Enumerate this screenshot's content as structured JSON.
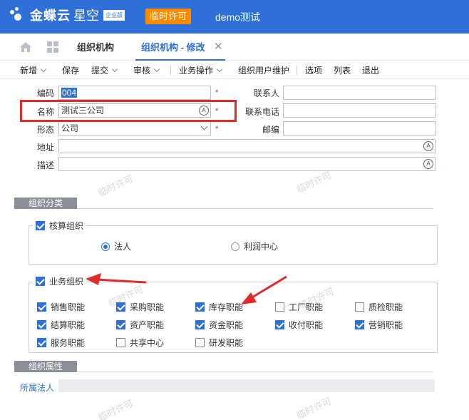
{
  "header": {
    "brand": "金蝶云",
    "brand_sub": "星空",
    "edition_badge": "企业版",
    "license_button": "临时许可",
    "tenant": "demo测试"
  },
  "tabs": [
    {
      "label": "组织机构"
    },
    {
      "label": "组织机构 - 修改"
    }
  ],
  "toolbar": {
    "new": "新增",
    "save": "保存",
    "submit": "提交",
    "audit": "审核",
    "business": "业务操作",
    "org_user": "组织用户维护",
    "options": "选项",
    "list": "列表",
    "exit": "退出"
  },
  "form": {
    "code_label": "编码",
    "code_value": "004",
    "name_label": "名称",
    "name_value": "测试三公司",
    "form_label": "形态",
    "form_value": "公司",
    "address_label": "地址",
    "desc_label": "描述",
    "contact_label": "联系人",
    "phone_label": "联系电话",
    "postcode_label": "邮编",
    "required_mark": "*",
    "at_symbol": "A"
  },
  "org_category": {
    "section_title": "组织分类",
    "accounting": {
      "title": "核算组织",
      "options": [
        {
          "label": "法人",
          "selected": true
        },
        {
          "label": "利润中心",
          "selected": false
        }
      ]
    },
    "business": {
      "title": "业务组织",
      "functions": [
        {
          "label": "销售职能",
          "checked": true
        },
        {
          "label": "采购职能",
          "checked": true
        },
        {
          "label": "库存职能",
          "checked": true
        },
        {
          "label": "工厂职能",
          "checked": false
        },
        {
          "label": "质检职能",
          "checked": false
        },
        {
          "label": "结算职能",
          "checked": true
        },
        {
          "label": "资产职能",
          "checked": true
        },
        {
          "label": "资金职能",
          "checked": true
        },
        {
          "label": "收付职能",
          "checked": true
        },
        {
          "label": "营销职能",
          "checked": true
        },
        {
          "label": "服务职能",
          "checked": true
        },
        {
          "label": "共享中心",
          "checked": false
        },
        {
          "label": "研发职能",
          "checked": false
        }
      ]
    }
  },
  "org_attr": {
    "section_title": "组织属性",
    "legal_entity_label": "所属法人"
  },
  "watermark": "临时许可",
  "colors": {
    "primary": "#2e6fd8",
    "license": "#ff8a00",
    "highlight": "#e02b2b"
  }
}
